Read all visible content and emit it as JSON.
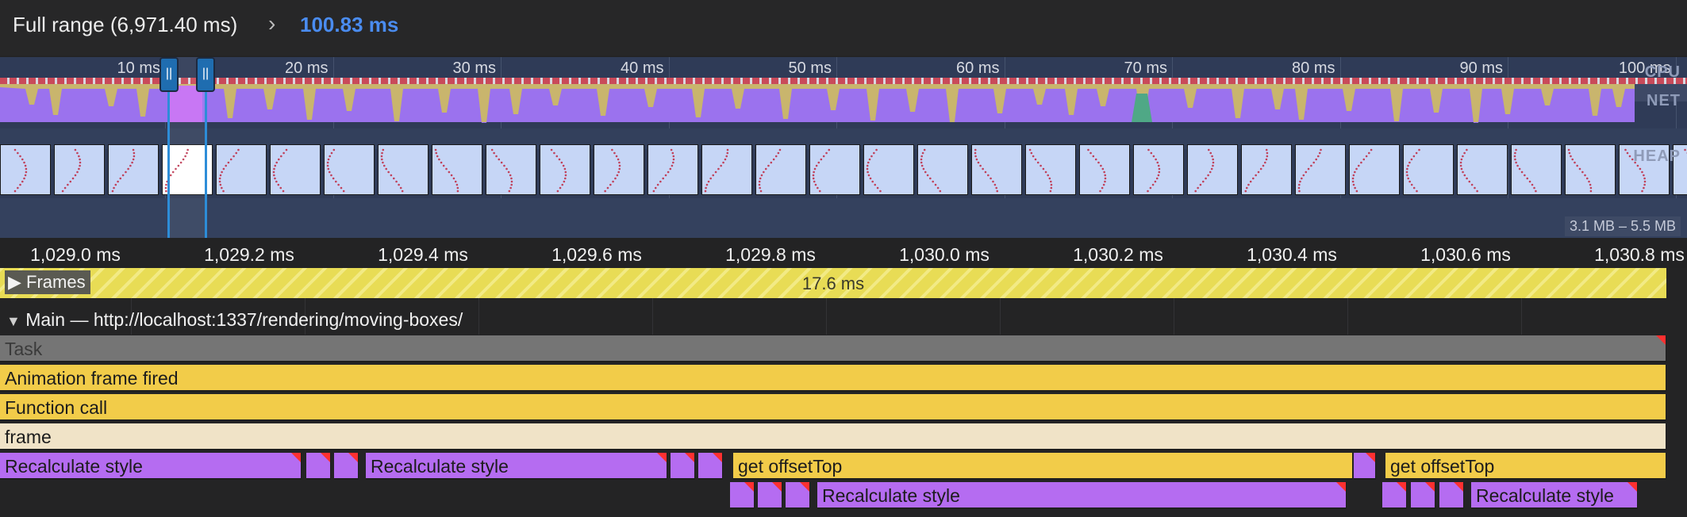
{
  "breadcrumb": {
    "full_range": "Full range (6,971.40 ms)",
    "chevron_icon": "chevron-right-icon",
    "selection": "100.83 ms"
  },
  "overview": {
    "ticks": [
      "10 ms",
      "20 ms",
      "30 ms",
      "40 ms",
      "50 ms",
      "60 ms",
      "70 ms",
      "80 ms",
      "90 ms",
      "100 ms"
    ],
    "tracks": {
      "cpu": "CPU",
      "net": "NET",
      "heap": "HEAP"
    },
    "heap_range": "3.1 MB – 5.5 MB"
  },
  "flame": {
    "ticks": [
      "1,029.0 ms",
      "1,029.2 ms",
      "1,029.4 ms",
      "1,029.6 ms",
      "1,029.8 ms",
      "1,030.0 ms",
      "1,030.2 ms",
      "1,030.4 ms",
      "1,030.6 ms",
      "1,030.8 ms"
    ],
    "frames": {
      "label": "Frames",
      "duration": "17.6 ms",
      "expand_icon": "triangle-right-icon"
    },
    "main": {
      "title": "Main — http://localhost:1337/rendering/moving-boxes/",
      "collapse_icon": "triangle-down-icon",
      "task": "Task",
      "animation_frame": "Animation frame fired",
      "function_call": "Function call",
      "frame": "frame",
      "recalc": "Recalculate style",
      "get_offset_top": "get offsetTop"
    }
  },
  "colors": {
    "selection": "#4a8cf0",
    "task": "#757575",
    "scripting": "#f2cc49",
    "rendering": "#b56cf1",
    "cpu_idle": "#c9b56d",
    "cpu_main": "#9b72ee"
  }
}
